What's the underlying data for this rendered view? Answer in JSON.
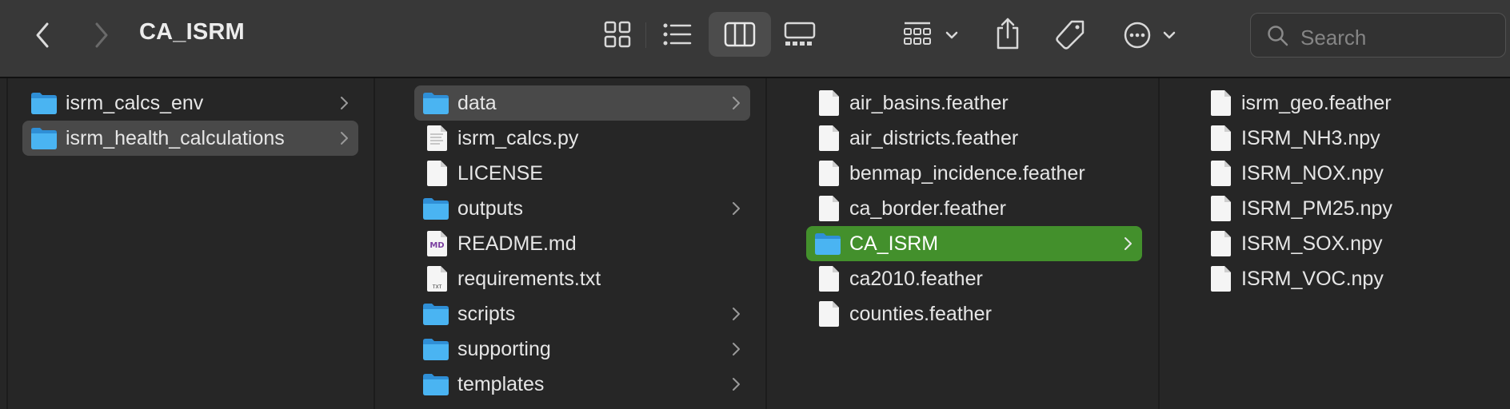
{
  "window": {
    "title": "CA_ISRM"
  },
  "toolbar": {
    "back_icon": "chevron-left-icon",
    "forward_icon": "chevron-right-icon",
    "view_modes": [
      "icon-view-icon",
      "list-view-icon",
      "column-view-icon",
      "gallery-view-icon"
    ],
    "selected_view": "column-view-icon",
    "group_icon": "group-by-icon",
    "share_icon": "share-icon",
    "tag_icon": "tag-icon",
    "more_icon": "ellipsis-circle-icon",
    "search_placeholder": "Search"
  },
  "colors": {
    "accent_selected": "#43902c",
    "folder": "#3aa8ee",
    "inactive_selection": "#494949"
  },
  "columns": [
    {
      "items": [
        {
          "name": "isrm_calcs_env",
          "kind": "folder",
          "has_children": true,
          "selected": false
        },
        {
          "name": "isrm_health_calculations",
          "kind": "folder",
          "has_children": true,
          "selected": true
        }
      ]
    },
    {
      "items": [
        {
          "name": "data",
          "kind": "folder",
          "has_children": true,
          "selected": true
        },
        {
          "name": "isrm_calcs.py",
          "kind": "python",
          "has_children": false,
          "selected": false
        },
        {
          "name": "LICENSE",
          "kind": "file",
          "has_children": false,
          "selected": false
        },
        {
          "name": "outputs",
          "kind": "folder",
          "has_children": true,
          "selected": false
        },
        {
          "name": "README.md",
          "kind": "markdown",
          "has_children": false,
          "selected": false
        },
        {
          "name": "requirements.txt",
          "kind": "text",
          "has_children": false,
          "selected": false
        },
        {
          "name": "scripts",
          "kind": "folder",
          "has_children": true,
          "selected": false
        },
        {
          "name": "supporting",
          "kind": "folder",
          "has_children": true,
          "selected": false
        },
        {
          "name": "templates",
          "kind": "folder",
          "has_children": true,
          "selected": false
        }
      ]
    },
    {
      "items": [
        {
          "name": "air_basins.feather",
          "kind": "file",
          "has_children": false,
          "selected": false
        },
        {
          "name": "air_districts.feather",
          "kind": "file",
          "has_children": false,
          "selected": false
        },
        {
          "name": "benmap_incidence.feather",
          "kind": "file",
          "has_children": false,
          "selected": false
        },
        {
          "name": "ca_border.feather",
          "kind": "file",
          "has_children": false,
          "selected": false
        },
        {
          "name": "CA_ISRM",
          "kind": "folder",
          "has_children": true,
          "selected": true,
          "active": true
        },
        {
          "name": "ca2010.feather",
          "kind": "file",
          "has_children": false,
          "selected": false
        },
        {
          "name": "counties.feather",
          "kind": "file",
          "has_children": false,
          "selected": false
        }
      ]
    },
    {
      "items": [
        {
          "name": "isrm_geo.feather",
          "kind": "file",
          "has_children": false,
          "selected": false
        },
        {
          "name": "ISRM_NH3.npy",
          "kind": "file",
          "has_children": false,
          "selected": false
        },
        {
          "name": "ISRM_NOX.npy",
          "kind": "file",
          "has_children": false,
          "selected": false
        },
        {
          "name": "ISRM_PM25.npy",
          "kind": "file",
          "has_children": false,
          "selected": false
        },
        {
          "name": "ISRM_SOX.npy",
          "kind": "file",
          "has_children": false,
          "selected": false
        },
        {
          "name": "ISRM_VOC.npy",
          "kind": "file",
          "has_children": false,
          "selected": false
        }
      ]
    }
  ]
}
